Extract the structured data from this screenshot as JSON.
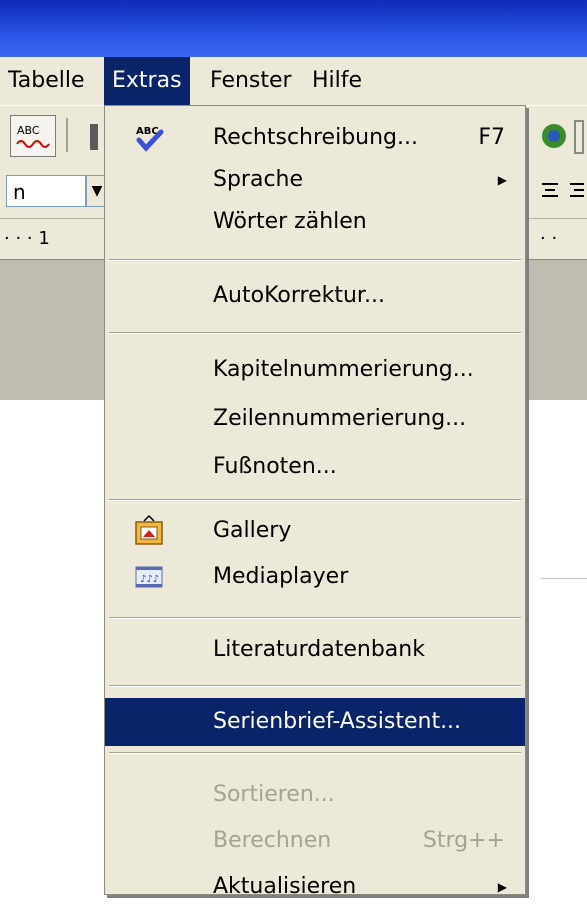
{
  "menubar": {
    "items": [
      "Tabelle",
      "Extras",
      "Fenster",
      "Hilfe"
    ]
  },
  "toolbar": {
    "font_box_value": "n",
    "ruler_left": "· · · 1",
    "ruler_right": "· ·"
  },
  "extras_menu": {
    "items": [
      {
        "label": "Rechtschreibung...",
        "shortcut": "F7",
        "icon": "spellcheck-icon"
      },
      {
        "label": "Sprache",
        "submenu": true
      },
      {
        "label": "Wörter zählen"
      },
      {
        "label": "AutoKorrektur..."
      },
      {
        "label": "Kapitelnummerierung..."
      },
      {
        "label": "Zeilennummerierung..."
      },
      {
        "label": "Fußnoten..."
      },
      {
        "label": "Gallery",
        "icon": "gallery-icon"
      },
      {
        "label": "Mediaplayer",
        "icon": "mediaplayer-icon"
      },
      {
        "label": "Literaturdatenbank"
      },
      {
        "label": "Serienbrief-Assistent...",
        "highlighted": true
      },
      {
        "label": "Sortieren...",
        "disabled": true
      },
      {
        "label": "Berechnen",
        "shortcut": "Strg++",
        "disabled": true
      },
      {
        "label": "Aktualisieren",
        "submenu": true
      }
    ]
  },
  "colors": {
    "highlight": "#0a246a",
    "menu_bg": "#ece9d8",
    "disabled_text": "#a5a291"
  }
}
